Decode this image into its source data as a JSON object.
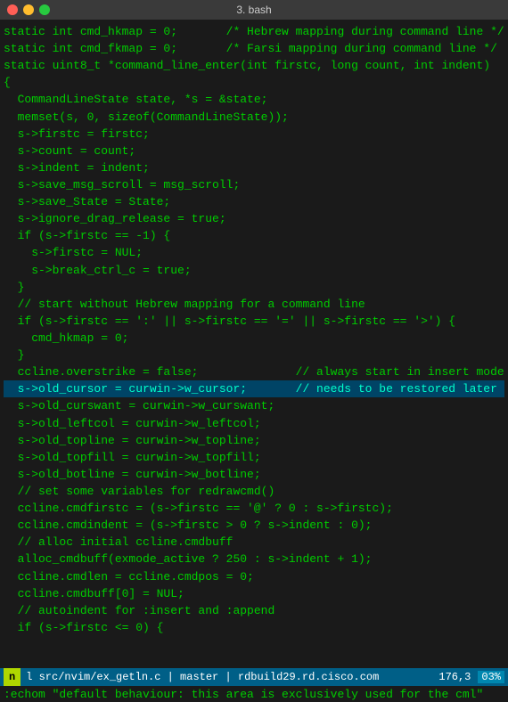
{
  "title": "3. bash",
  "status": {
    "mode": "n",
    "file": "l  src/nvim/ex_getln.c",
    "branch": "master",
    "server": "rdbuild29.rd.cisco.com",
    "position": "176,3",
    "percent": "03%"
  },
  "cmdline": ":echom \"default behaviour: this area is exclusively used for the cml\"",
  "lines": [
    "",
    "static int cmd_hkmap = 0;       /* Hebrew mapping during command line */",
    "",
    "static int cmd_fkmap = 0;       /* Farsi mapping during command line */",
    "static uint8_t *command_line_enter(int firstc, long count, int indent)",
    "{",
    "  CommandLineState state, *s = &state;",
    "  memset(s, 0, sizeof(CommandLineState));",
    "  s->firstc = firstc;",
    "  s->count = count;",
    "  s->indent = indent;",
    "  s->save_msg_scroll = msg_scroll;",
    "  s->save_State = State;",
    "  s->ignore_drag_release = true;",
    "",
    "  if (s->firstc == -1) {",
    "    s->firstc = NUL;",
    "    s->break_ctrl_c = true;",
    "  }",
    "",
    "  // start without Hebrew mapping for a command line",
    "  if (s->firstc == ':' || s->firstc == '=' || s->firstc == '>') {",
    "    cmd_hkmap = 0;",
    "  }",
    "",
    "  ccline.overstrike = false;              // always start in insert mode",
    "  s->old_cursor = curwin->w_cursor;       // needs to be restored later",
    "  s->old_curswant = curwin->w_curswant;",
    "  s->old_leftcol = curwin->w_leftcol;",
    "  s->old_topline = curwin->w_topline;",
    "  s->old_topfill = curwin->w_topfill;",
    "  s->old_botline = curwin->w_botline;",
    "",
    "  // set some variables for redrawcmd()",
    "  ccline.cmdfirstc = (s->firstc == '@' ? 0 : s->firstc);",
    "  ccline.cmdindent = (s->firstc > 0 ? s->indent : 0);",
    "",
    "  // alloc initial ccline.cmdbuff",
    "  alloc_cmdbuff(exmode_active ? 250 : s->indent + 1);",
    "  ccline.cmdlen = ccline.cmdpos = 0;",
    "  ccline.cmdbuff[0] = NUL;",
    "",
    "  // autoindent for :insert and :append",
    "  if (s->firstc <= 0) {"
  ]
}
